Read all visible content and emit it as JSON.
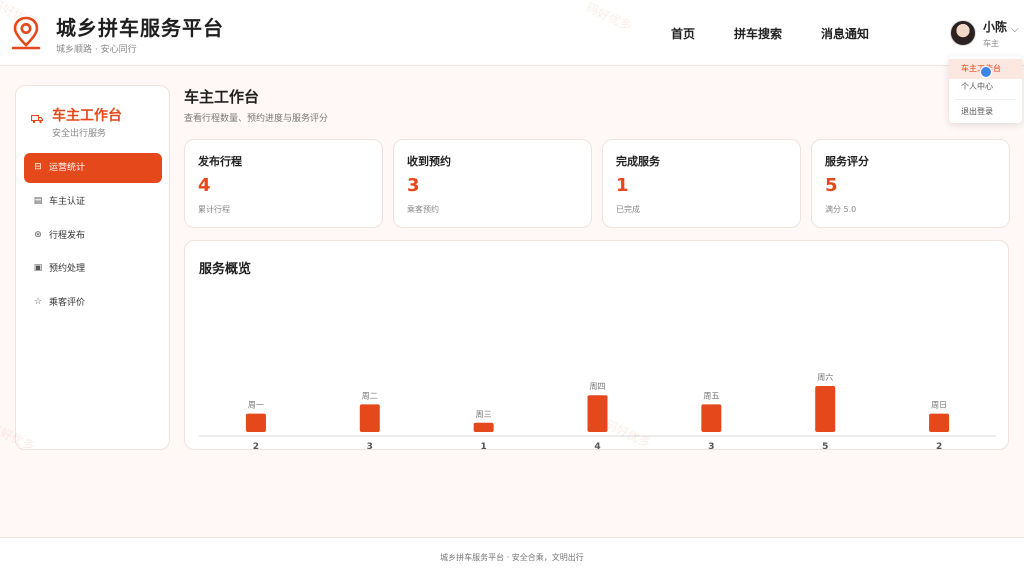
{
  "header": {
    "title": "城乡拼车服务平台",
    "subtitle": "城乡顺路 · 安心同行",
    "nav": [
      "首页",
      "拼车搜索",
      "消息通知"
    ],
    "user": {
      "name": "小陈",
      "role": "车主"
    }
  },
  "dropdown": {
    "items": [
      "车主工作台",
      "个人中心",
      "退出登录"
    ],
    "active_index": 0
  },
  "sidebar": {
    "title": "车主工作台",
    "subtitle": "安全出行服务",
    "items": [
      {
        "label": "运营统计",
        "icon": "chart-icon",
        "active": true
      },
      {
        "label": "车主认证",
        "icon": "clipboard-icon",
        "active": false
      },
      {
        "label": "行程发布",
        "icon": "route-icon",
        "active": false
      },
      {
        "label": "预约处理",
        "icon": "document-icon",
        "active": false
      },
      {
        "label": "乘客评价",
        "icon": "star-icon",
        "active": false
      }
    ]
  },
  "main": {
    "title": "车主工作台",
    "description": "查看行程数量、预约进度与服务评分",
    "stats": [
      {
        "label": "发布行程",
        "value": "4",
        "note": "累计行程"
      },
      {
        "label": "收到预约",
        "value": "3",
        "note": "乘客预约"
      },
      {
        "label": "完成服务",
        "value": "1",
        "note": "已完成"
      },
      {
        "label": "服务评分",
        "value": "5",
        "note": "满分 5.0"
      }
    ],
    "overview_title": "服务概览"
  },
  "chart_data": {
    "type": "bar",
    "categories": [
      "周一",
      "周二",
      "周三",
      "周四",
      "周五",
      "周六",
      "周日"
    ],
    "values": [
      2,
      3,
      1,
      4,
      3,
      5,
      2
    ],
    "title": "服务概览",
    "xlabel": "",
    "ylabel": "",
    "grid": false,
    "legend": "none",
    "color": "#e5481a"
  },
  "footer": {
    "text": "城乡拼车服务平台 · 安全合乘，文明出行"
  },
  "colors": {
    "accent": "#e5481a",
    "background": "#fff8f6"
  },
  "watermark": "码好优多"
}
